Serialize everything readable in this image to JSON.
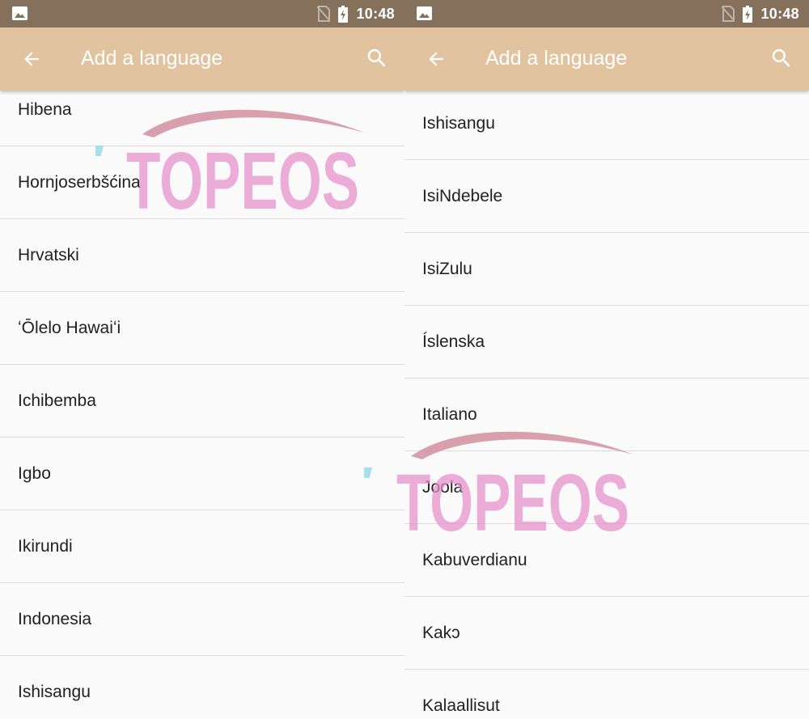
{
  "status_bar": {
    "time": "10:48",
    "icons": [
      "gallery-icon",
      "no-sim-icon",
      "battery-charging-icon"
    ]
  },
  "app_bar": {
    "title": "Add a language",
    "back_icon": "arrow-back-icon",
    "search_icon": "search-icon"
  },
  "screens": [
    {
      "languages": [
        "Hibena",
        "Hornjoserbšćina",
        "Hrvatski",
        "ʻŌlelo Hawaiʻi",
        "Ichibemba",
        "Igbo",
        "Ikirundi",
        "Indonesia",
        "Ishisangu"
      ]
    },
    {
      "languages": [
        "Ishisangu",
        "IsiNdebele",
        "IsiZulu",
        "Íslenska",
        "Italiano",
        "Joola",
        "Kabuverdianu",
        "Kakɔ",
        "Kalaallisut"
      ]
    }
  ],
  "watermark": {
    "text": "TOPEOS"
  },
  "colors": {
    "status_bar": "#85705c",
    "app_bar": "#e1c3a0",
    "list_bg": "#fafafa",
    "divider": "#dcdcdc",
    "text": "#212121",
    "watermark_pink": "#e48fc9",
    "watermark_rose": "#c98585",
    "watermark_cyan": "#9ad8ea"
  }
}
